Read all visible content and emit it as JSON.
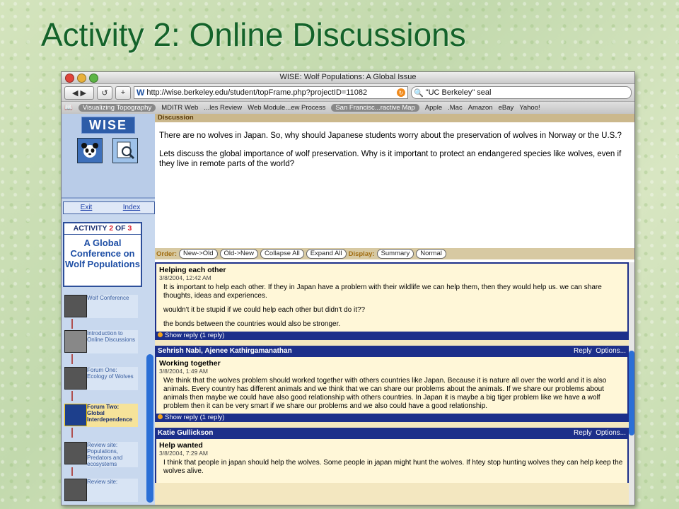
{
  "slide": {
    "title": "Activity 2: Online Discussions"
  },
  "browser": {
    "window_title": "WISE: Wolf Populations: A Global Issue",
    "url": "http://wise.berkeley.edu/student/topFrame.php?projectID=11082",
    "search_query": "\"UC Berkeley\" seal",
    "bookmarks": [
      "Visualizing Topography",
      "MDITR Web",
      "...les Review",
      "Web Module...ew Process",
      "San Francisc...ractive Map",
      "Apple",
      ".Mac",
      "Amazon",
      "eBay",
      "Yahoo!"
    ]
  },
  "sidebar": {
    "logo": "WISE",
    "exit_label": "Exit",
    "index_label": "Index",
    "activity_prefix": "ACTIVITY",
    "activity_num": "2",
    "activity_of": "OF",
    "activity_total": "3",
    "activity_title": "A Global Conference on Wolf Populations",
    "steps": [
      {
        "label": "Wolf Conference"
      },
      {
        "label": "Introduction to Online Discussions"
      },
      {
        "label": "Forum One: Ecology of Wolves"
      },
      {
        "label": "Forum Two: Global Interdependence"
      },
      {
        "label": "Review site: Populations, Predators and ecosystems"
      },
      {
        "label": "Review site:"
      }
    ]
  },
  "discussion": {
    "section_label": "Discussion",
    "prompt_1": "There are no wolves in Japan. So, why should Japanese students worry about the preservation of wolves in Norway or the U.S.?",
    "prompt_2": "Lets discuss the global importance of wolf preservation. Why is it important to protect an endangered species like wolves, even if they live in remote parts of the world?",
    "order_label": "Order:",
    "order_buttons": [
      "New->Old",
      "Old->New",
      "Collapse All",
      "Expand All"
    ],
    "display_label": "Display:",
    "display_buttons": [
      "Summary",
      "Normal"
    ]
  },
  "posts": [
    {
      "author": "",
      "title": "Helping each other",
      "date": "3/8/2004, 12:42 AM",
      "paragraphs": [
        "It is important to help each other. If they in Japan have a problem with their wildlife we can help them, then they would help us. we can share thoughts, ideas and experiences.",
        "wouldn't it be stupid if we could help each other but didn't do it??",
        "the bonds between the countries would also be stronger."
      ],
      "reply_link": "Show reply (1 reply)"
    },
    {
      "author": "Sehrish Nabi, Ajenee Kathirgamanathan",
      "title": "Working together",
      "date": "3/8/2004, 1:49 AM",
      "paragraphs": [
        "We think that the wolves problem should worked together with others countries like Japan. Because it is nature all over the world and it is also animals. Every country has different animals and we think that we can share our problems about the animals. If we share our problems about animals then maybe we could have also good relationship with others countries. In Japan it is maybe a big tiger problem like we have a wolf problem then it can be very smart if we share our problems and we also could have a good relationship."
      ],
      "reply_link": "Show reply (1 reply)"
    },
    {
      "author": "Katie Gullickson",
      "title": "Help wanted",
      "date": "3/8/2004, 7:29 AM",
      "paragraphs": [
        "I think that people in japan should help the wolves. Some people in japan might hunt the wolves. If htey stop hunting wolves they can help keep the wolves alive."
      ],
      "reply_link": ""
    }
  ],
  "post_actions": {
    "reply": "Reply",
    "options": "Options..."
  }
}
